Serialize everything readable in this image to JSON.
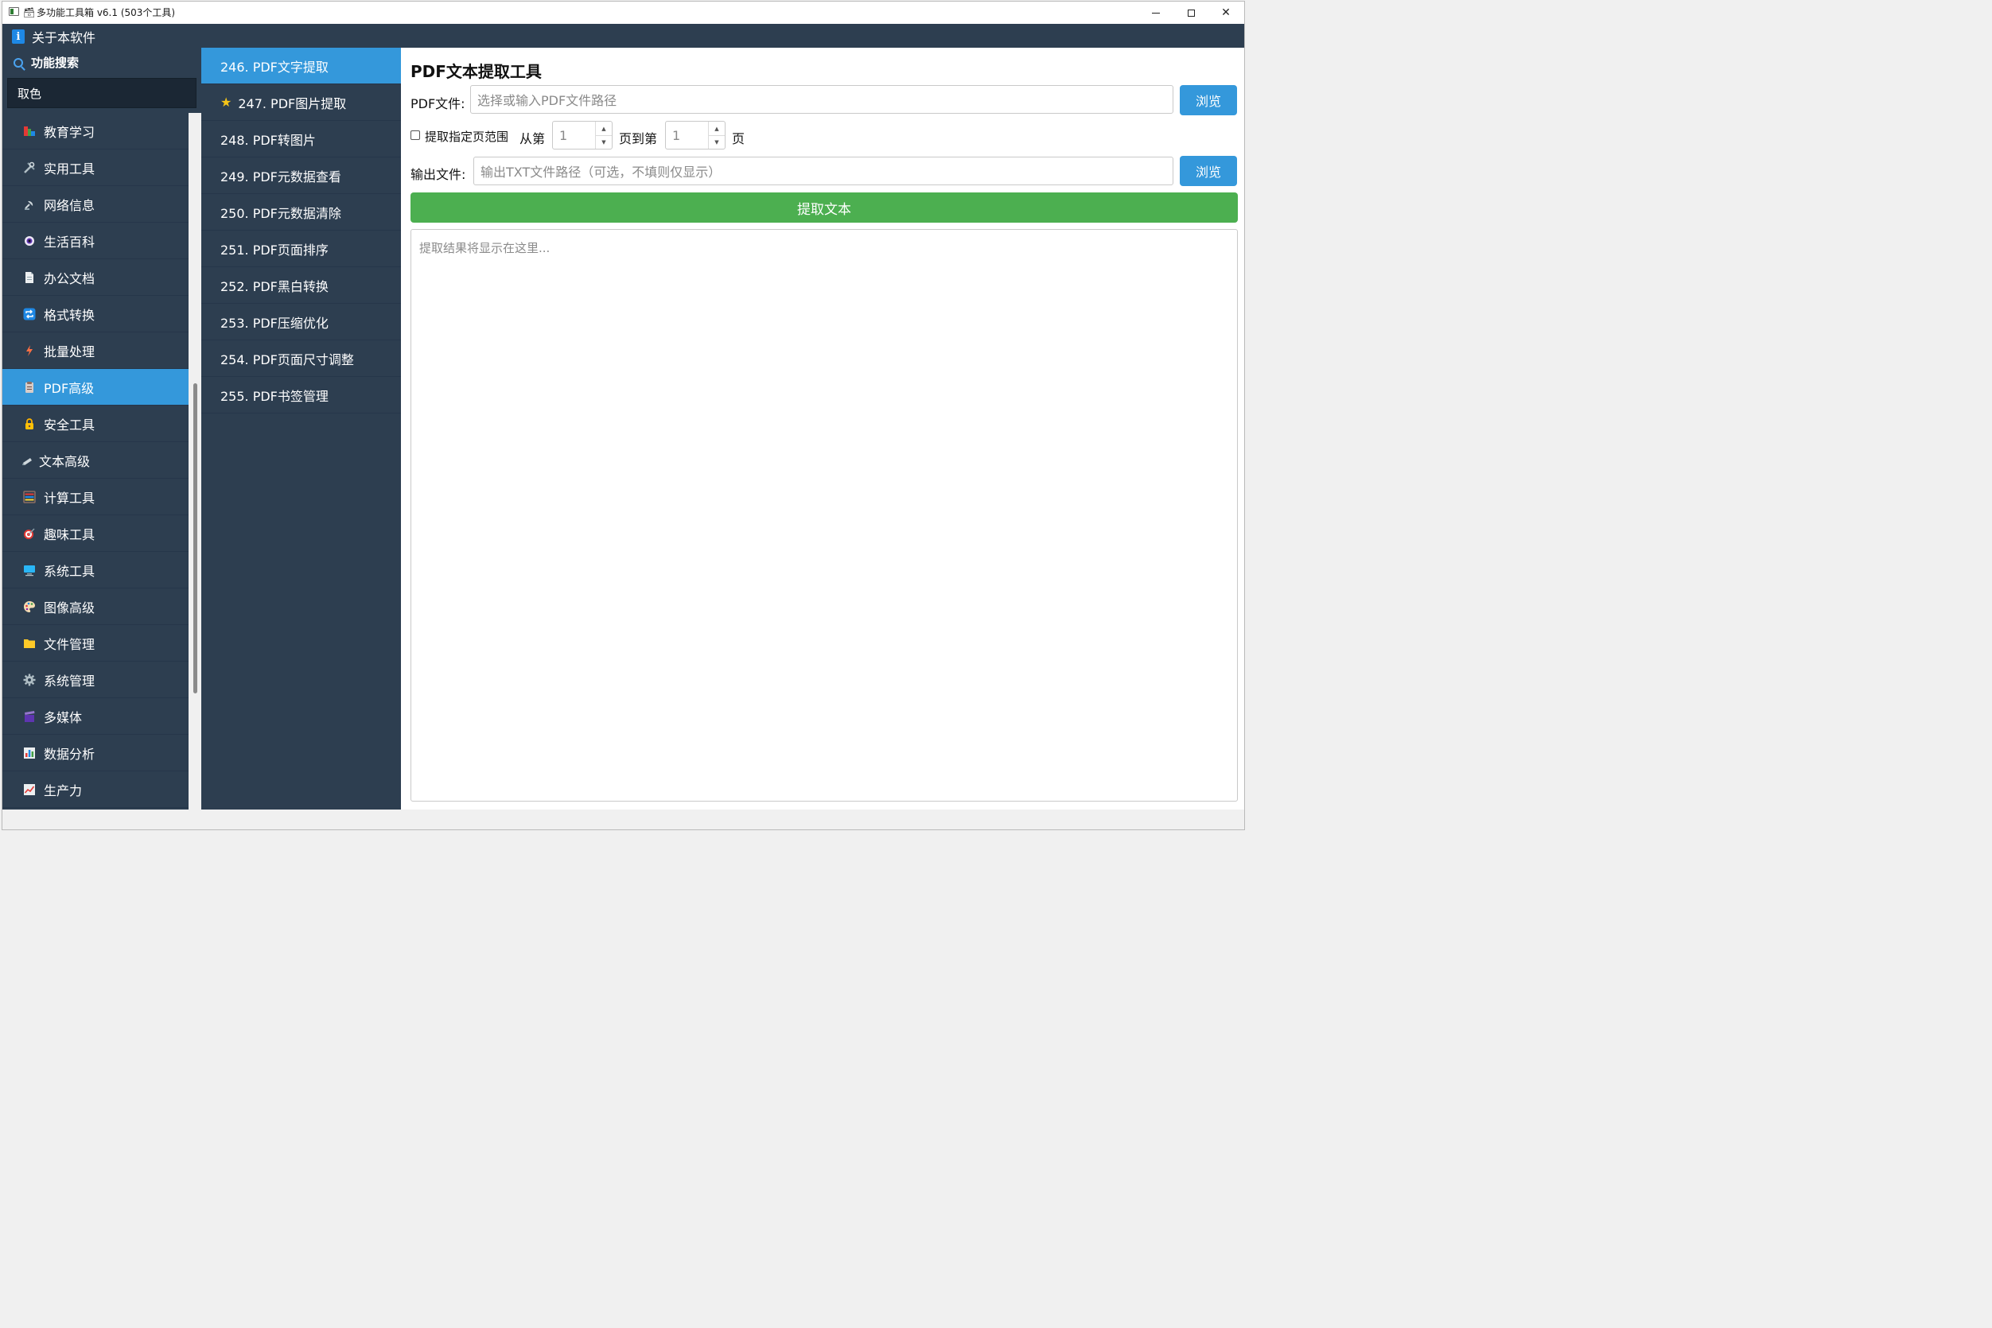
{
  "window": {
    "title_icon": "🗃",
    "title": "多功能工具箱 v6.1 (503个工具)"
  },
  "header": {
    "about_icon": "i",
    "about_label": "关于本软件"
  },
  "search": {
    "label": "功能搜索",
    "value": "取色"
  },
  "categories": [
    {
      "label": "教育学习",
      "icon": "books-icon"
    },
    {
      "label": "实用工具",
      "icon": "tools-icon"
    },
    {
      "label": "网络信息",
      "icon": "satellite-icon"
    },
    {
      "label": "生活百科",
      "icon": "eye-icon"
    },
    {
      "label": "办公文档",
      "icon": "document-icon"
    },
    {
      "label": "格式转换",
      "icon": "repeat-icon"
    },
    {
      "label": "批量处理",
      "icon": "lightning-icon"
    },
    {
      "label": "PDF高级",
      "icon": "clipboard-icon",
      "active": true
    },
    {
      "label": "安全工具",
      "icon": "lock-icon"
    },
    {
      "label": "文本高级",
      "icon": "pencil-icon"
    },
    {
      "label": "计算工具",
      "icon": "abacus-icon"
    },
    {
      "label": "趣味工具",
      "icon": "target-icon"
    },
    {
      "label": "系统工具",
      "icon": "computer-icon"
    },
    {
      "label": "图像高级",
      "icon": "palette-icon"
    },
    {
      "label": "文件管理",
      "icon": "folder-icon"
    },
    {
      "label": "系统管理",
      "icon": "gear-icon"
    },
    {
      "label": "多媒体",
      "icon": "clapper-icon"
    },
    {
      "label": "数据分析",
      "icon": "bar-chart-icon"
    },
    {
      "label": "生产力",
      "icon": "trend-icon"
    }
  ],
  "tools": [
    {
      "label": "246. PDF文字提取",
      "active": true
    },
    {
      "label": "247. PDF图片提取",
      "starred": true
    },
    {
      "label": "248. PDF转图片"
    },
    {
      "label": "249. PDF元数据查看"
    },
    {
      "label": "250. PDF元数据清除"
    },
    {
      "label": "251. PDF页面排序"
    },
    {
      "label": "252. PDF黑白转换"
    },
    {
      "label": "253. PDF压缩优化"
    },
    {
      "label": "254. PDF页面尺寸调整"
    },
    {
      "label": "255. PDF书签管理"
    }
  ],
  "panel": {
    "title": "PDF文本提取工具",
    "pdf_label": "PDF文件:",
    "pdf_placeholder": "选择或输入PDF文件路径",
    "browse_label": "浏览",
    "range_checkbox_label": "提取指定页范围",
    "from_label": "从第",
    "from_value": "1",
    "to_label": "页到第",
    "to_value": "1",
    "page_suffix": "页",
    "output_label": "输出文件:",
    "output_placeholder": "输出TXT文件路径（可选，不填则仅显示）",
    "browse2_label": "浏览",
    "extract_label": "提取文本",
    "result_placeholder": "提取结果将显示在这里..."
  }
}
